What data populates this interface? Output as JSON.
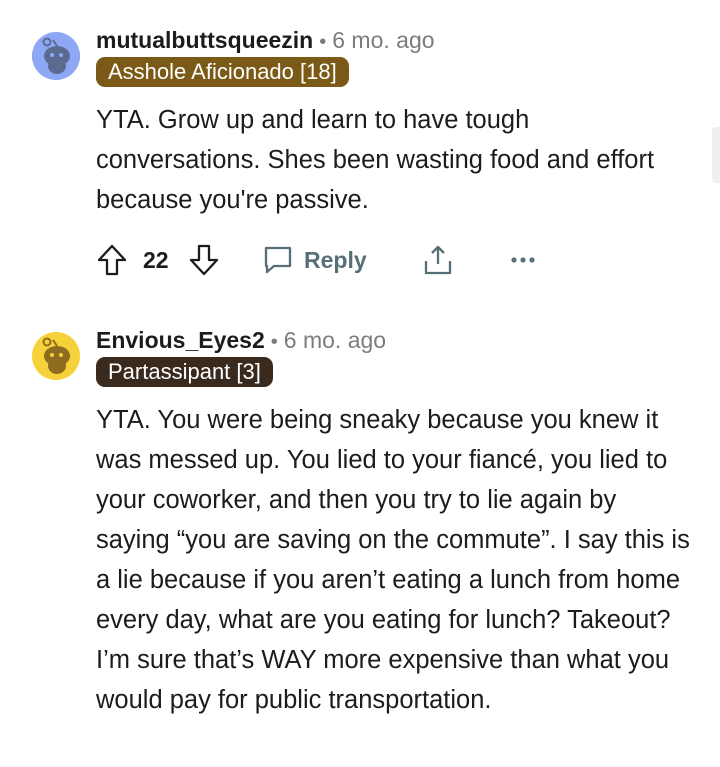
{
  "comments": [
    {
      "username": "mutualbuttsqueezin",
      "separator": "•",
      "time": "6 mo. ago",
      "flair": "Asshole Aficionado [18]",
      "flair_color": "#7a5a16",
      "avatar_color": "#8fa8f5",
      "avatar_icon": "snoo-avatar-icon",
      "body": "YTA. Grow up and learn to have tough conversations. Shes been wasting food and effort because you're passive.",
      "votes": "22",
      "reply_label": "Reply"
    },
    {
      "username": "Envious_Eyes2",
      "separator": "•",
      "time": "6 mo. ago",
      "flair": "Partassipant [3]",
      "flair_color": "#3a2a1e",
      "avatar_color": "#f6d23a",
      "avatar_icon": "snoo-avatar-icon",
      "body": "YTA. You were being sneaky because you knew it was messed up. You lied to your fiancé, you lied to your coworker, and then you try to lie again by saying “you are saving on the commute”. I say this is a lie because if you aren’t eating a lunch from home every day, what are you eating for lunch? Takeout? I’m sure that’s WAY more expensive than what you would pay for public transportation."
    }
  ],
  "icons": {
    "upvote": "upvote-arrow-icon",
    "downvote": "downvote-arrow-icon",
    "reply": "reply-bubble-icon",
    "share": "share-icon",
    "more": "more-options-icon"
  }
}
